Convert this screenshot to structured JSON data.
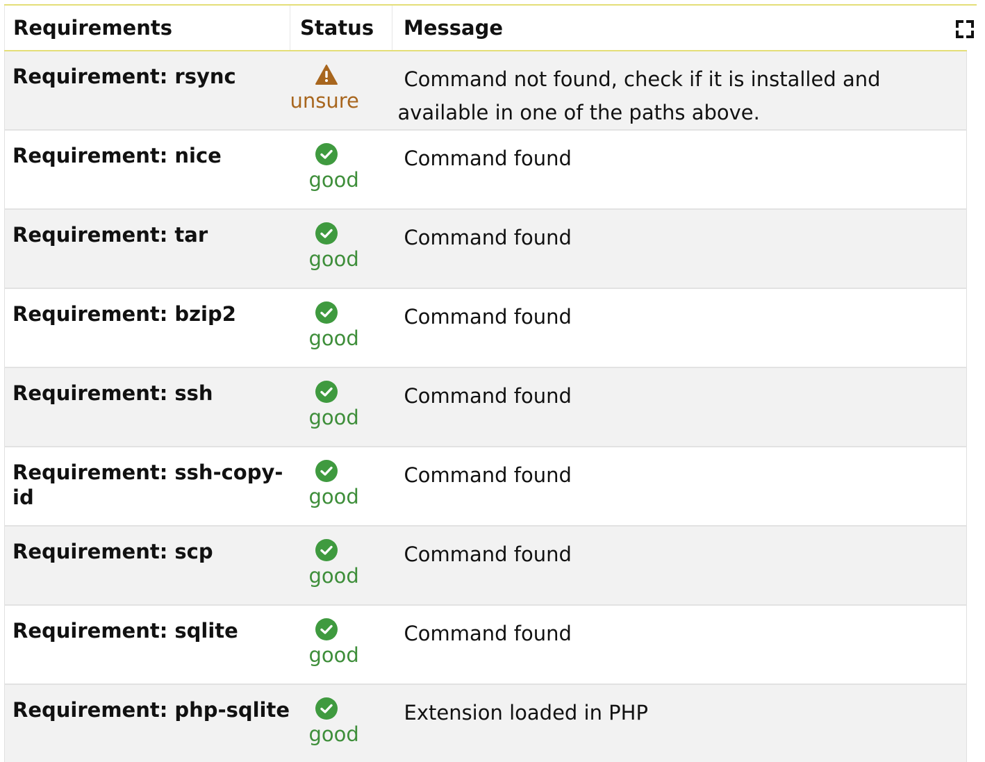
{
  "table": {
    "headers": {
      "requirement": "Requirements",
      "status": "Status",
      "message": "Message"
    },
    "rows": [
      {
        "name": "Requirement: rsync",
        "status": "unsure",
        "status_icon": "warning-triangle-icon",
        "message": "Command not found, check if it is installed and available in one of the paths above."
      },
      {
        "name": "Requirement: nice",
        "status": "good",
        "status_icon": "check-circle-icon",
        "message": "Command found"
      },
      {
        "name": "Requirement: tar",
        "status": "good",
        "status_icon": "check-circle-icon",
        "message": "Command found"
      },
      {
        "name": "Requirement: bzip2",
        "status": "good",
        "status_icon": "check-circle-icon",
        "message": "Command found"
      },
      {
        "name": "Requirement: ssh",
        "status": "good",
        "status_icon": "check-circle-icon",
        "message": "Command found"
      },
      {
        "name": "Requirement: ssh-copy-id",
        "status": "good",
        "status_icon": "check-circle-icon",
        "message": "Command found"
      },
      {
        "name": "Requirement: scp",
        "status": "good",
        "status_icon": "check-circle-icon",
        "message": "Command found"
      },
      {
        "name": "Requirement: sqlite",
        "status": "good",
        "status_icon": "check-circle-icon",
        "message": "Command found"
      },
      {
        "name": "Requirement: php-sqlite",
        "status": "good",
        "status_icon": "check-circle-icon",
        "message": "Extension loaded in PHP"
      }
    ]
  },
  "toolbar": {
    "expand_icon": "fullscreen-expand-icon"
  },
  "colors": {
    "good": "#3e8e3a",
    "good_icon": "#3f9a3f",
    "unsure": "#a8661e",
    "accent_rule": "#e4de78",
    "row_alt": "#f2f2f2"
  }
}
